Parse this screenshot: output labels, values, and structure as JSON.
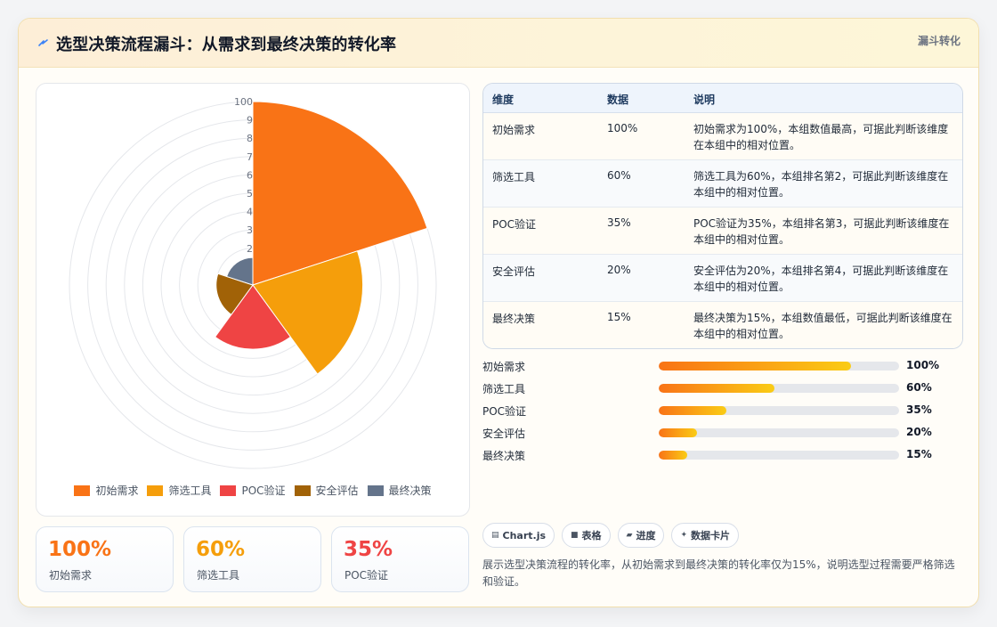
{
  "header": {
    "icon": "lightning-bolt-icon",
    "title": "选型决策流程漏斗：从需求到最终决策的转化率",
    "tag": "漏斗转化"
  },
  "chart_data": {
    "type": "polarArea",
    "categories": [
      "初始需求",
      "筛选工具",
      "POC验证",
      "安全评估",
      "最终决策"
    ],
    "values": [
      100,
      60,
      35,
      20,
      15
    ],
    "colors": [
      "#f97316",
      "#f59e0b",
      "#ef4444",
      "#a16207",
      "#64748b"
    ],
    "r_ticks": [
      "2",
      "3",
      "4",
      "5",
      "6",
      "7",
      "8",
      "9",
      "100"
    ],
    "r_max": 100,
    "legend_position": "bottom",
    "grid": true
  },
  "stats": [
    {
      "value": "100%",
      "label": "初始需求",
      "color": "#f97316"
    },
    {
      "value": "60%",
      "label": "筛选工具",
      "color": "#f59e0b"
    },
    {
      "value": "35%",
      "label": "POC验证",
      "color": "#ef4444"
    }
  ],
  "table": {
    "headers": [
      "维度",
      "数据",
      "说明"
    ],
    "rows": [
      {
        "dim": "初始需求",
        "val": "100%",
        "note": "初始需求为100%，本组数值最高，可据此判断该维度在本组中的相对位置。"
      },
      {
        "dim": "筛选工具",
        "val": "60%",
        "note": "筛选工具为60%，本组排名第2，可据此判断该维度在本组中的相对位置。"
      },
      {
        "dim": "POC验证",
        "val": "35%",
        "note": "POC验证为35%，本组排名第3，可据此判断该维度在本组中的相对位置。"
      },
      {
        "dim": "安全评估",
        "val": "20%",
        "note": "安全评估为20%，本组排名第4，可据此判断该维度在本组中的相对位置。"
      },
      {
        "dim": "最终决策",
        "val": "15%",
        "note": "最终决策为15%，本组数值最低，可据此判断该维度在本组中的相对位置。"
      }
    ]
  },
  "progress": [
    {
      "label": "初始需求",
      "value": "100%",
      "fraction": 0.8
    },
    {
      "label": "筛选工具",
      "value": "60%",
      "fraction": 0.48
    },
    {
      "label": "POC验证",
      "value": "35%",
      "fraction": 0.28
    },
    {
      "label": "安全评估",
      "value": "20%",
      "fraction": 0.16
    },
    {
      "label": "最终决策",
      "value": "15%",
      "fraction": 0.12
    }
  ],
  "chips": [
    {
      "icon": "chart-icon",
      "glyph": "▤",
      "label": "Chart.js"
    },
    {
      "icon": "table-icon",
      "glyph": "■",
      "label": "表格"
    },
    {
      "icon": "progress-icon",
      "glyph": "▰",
      "label": "进度"
    },
    {
      "icon": "sparkle-icon",
      "glyph": "✦",
      "label": "数据卡片"
    }
  ],
  "description": "展示选型决策流程的转化率，从初始需求到最终决策的转化率仅为15%，说明选型过程需要严格筛选和验证。"
}
